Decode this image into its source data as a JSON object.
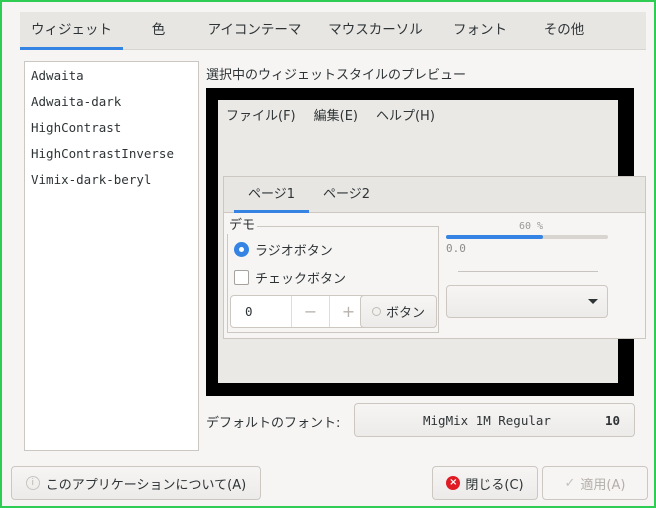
{
  "tabs": [
    {
      "label": "ウィジェット",
      "active": true
    },
    {
      "label": "色",
      "active": false
    },
    {
      "label": "アイコンテーマ",
      "active": false
    },
    {
      "label": "マウスカーソル",
      "active": false
    },
    {
      "label": "フォント",
      "active": false
    },
    {
      "label": "その他",
      "active": false
    }
  ],
  "themes": [
    "Adwaita",
    "Adwaita-dark",
    "HighContrast",
    "HighContrastInverse",
    "Vimix-dark-beryl"
  ],
  "preview": {
    "label": "選択中のウィジェットスタイルのプレビュー",
    "menu": [
      "ファイル(F)",
      "編集(E)",
      "ヘルプ(H)"
    ],
    "pages": [
      "ページ1",
      "ページ2"
    ],
    "demo_label": "デモ",
    "radio_label": "ラジオボタン",
    "check_label": "チェックボタン",
    "spin_value": "0",
    "spin_minus": "−",
    "spin_plus": "+",
    "button_label": "ボタン",
    "progress_text": "60 %",
    "progress_fraction": 0.6,
    "scale_value": "0.0"
  },
  "font": {
    "label": "デフォルトのフォント:",
    "name": "MigMix 1M Regular",
    "size": "10"
  },
  "buttons": {
    "about": "このアプリケーションについて(A)",
    "close": "閉じる(C)",
    "apply": "適用(A)"
  },
  "colors": {
    "accent": "#3584e4",
    "window_border": "#2ecc52",
    "close_icon": "#e01b24"
  }
}
